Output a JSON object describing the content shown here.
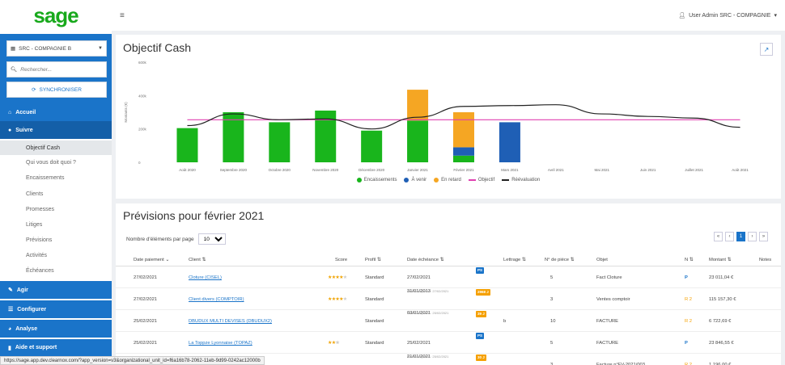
{
  "brand": {
    "logo": "sage",
    "color": "#18a91c"
  },
  "header": {
    "menu_icon": "hamburger-icon",
    "user": "User Admin SRC - COMPAGNIE"
  },
  "sidebar": {
    "company": "SRC - COMPAGNIE B",
    "search_placeholder": "Rechercher...",
    "sync_label": "SYNCHRONISER",
    "items": [
      {
        "label": "Accueil"
      },
      {
        "label": "Suivre"
      },
      {
        "label": "Agir"
      },
      {
        "label": "Configurer"
      },
      {
        "label": "Analyse"
      },
      {
        "label": "Aide et support"
      }
    ],
    "sub_items": [
      "Objectif Cash",
      "Qui vous doit quoi ?",
      "Encaissements",
      "Clients",
      "Promesses",
      "Litiges",
      "Prévisions",
      "Activités",
      "Échéances"
    ]
  },
  "chart_card": {
    "title": "Objectif Cash"
  },
  "chart_data": {
    "type": "bar",
    "ylabel": "Montants (€)",
    "ylim": [
      0,
      600000
    ],
    "yticks": [
      "0",
      "200k",
      "400k",
      "600k"
    ],
    "categories": [
      "Août 2020",
      "Septembre 2020",
      "Octobre 2020",
      "Novembre 2020",
      "Décembre 2020",
      "Janvier 2021",
      "Février 2021",
      "Mars 2021",
      "Avril 2021",
      "Mai 2021",
      "Juin 2021",
      "Juillet 2021",
      "Août 2021"
    ],
    "series": [
      {
        "name": "Encaissements",
        "color": "#19b51c",
        "values": [
          205000,
          300000,
          240000,
          310000,
          190000,
          250000,
          40000,
          0,
          0,
          0,
          0,
          0,
          0
        ]
      },
      {
        "name": "À venir",
        "color": "#1f5fb5",
        "values": [
          0,
          0,
          0,
          0,
          0,
          0,
          50000,
          240000,
          0,
          0,
          0,
          0,
          0
        ]
      },
      {
        "name": "En retard",
        "color": "#f5a623",
        "values": [
          0,
          0,
          0,
          0,
          0,
          185000,
          210000,
          0,
          0,
          0,
          0,
          0,
          0
        ]
      },
      {
        "name": "Objectif",
        "color": "#e040b0",
        "type": "line",
        "values": [
          255000,
          255000,
          255000,
          255000,
          255000,
          255000,
          255000,
          255000,
          255000,
          255000,
          255000,
          255000,
          255000
        ]
      },
      {
        "name": "Réévaluation",
        "color": "#222222",
        "type": "line",
        "values": [
          220000,
          290000,
          255000,
          260000,
          200000,
          270000,
          335000,
          340000,
          345000,
          290000,
          275000,
          265000,
          210000
        ]
      }
    ],
    "legend": "bottom",
    "grid": false
  },
  "table_card": {
    "title": "Prévisions pour février 2021",
    "page_size_label": "Nombre d'éléments par page",
    "page_size": "10",
    "pager": [
      "«",
      "‹",
      "1",
      "›",
      "»"
    ],
    "columns": [
      "Date paiement",
      "Client",
      "Score",
      "Profil",
      "Date échéance",
      "Lettrage",
      "N° de pièce",
      "Objet",
      "N",
      "Montant",
      "Notes"
    ],
    "rows": [
      {
        "date": "27/02/2021",
        "client": "Cloture (CISEL)",
        "stars": 4,
        "profil": "Standard",
        "echeance": "27/02/2021",
        "sub": "",
        "badge": "PS",
        "badge_color": "#1a74c9",
        "lettrage": "",
        "piece": "5",
        "objet": "Fact Cloture",
        "n": "P",
        "n_type": "p",
        "montant": "23 011,04 €"
      },
      {
        "date": "27/02/2021",
        "client": "Client divers (COMPTOIR)",
        "stars": 4,
        "profil": "Standard",
        "echeance": "31/01/2013",
        "sub": "Paiement prévu : 27/02/2021",
        "badge": "2968 J",
        "badge_color": "#f5a000",
        "lettrage": "",
        "piece": "3",
        "objet": "Ventes comptoir",
        "n": "R 2",
        "n_type": "r",
        "montant": "115 157,30 €"
      },
      {
        "date": "25/02/2021",
        "client": "DBUDUX MULTI DEVISES (DBUDUX2)",
        "stars": 0,
        "profil": "Standard",
        "echeance": "03/01/2021",
        "sub": "Paiement prévu : 25/02/2021",
        "badge": "39 J",
        "badge_color": "#f5a000",
        "lettrage": "b",
        "piece": "10",
        "objet": "FACTURE",
        "n": "R 2",
        "n_type": "r",
        "montant": "6 722,69 €"
      },
      {
        "date": "25/02/2021",
        "client": "La Toppze Lyonnaise (TOPAZ)",
        "stars": 2,
        "profil": "Standard",
        "echeance": "25/02/2021",
        "sub": "",
        "badge": "PS",
        "badge_color": "#1a74c9",
        "lettrage": "",
        "piece": "5",
        "objet": "FACTURE",
        "n": "P",
        "n_type": "p",
        "montant": "23 846,55 €"
      },
      {
        "date": "",
        "client": "",
        "stars": 0,
        "profil": "",
        "echeance": "21/01/2021",
        "sub": "Paiement prévu : 25/02/2021",
        "badge": "30 J",
        "badge_color": "#f5a000",
        "lettrage": "",
        "piece": "3",
        "objet": "Facture n°FV-2021/003",
        "n": "R 2",
        "n_type": "r",
        "montant": "1 196,00 €"
      }
    ]
  },
  "statusbar": "https://sage.app.dev.clearnox.com/?app_version=v3&organizational_unit_id=f6a16b78-2062-11eb-9d99-0242ac12000b"
}
